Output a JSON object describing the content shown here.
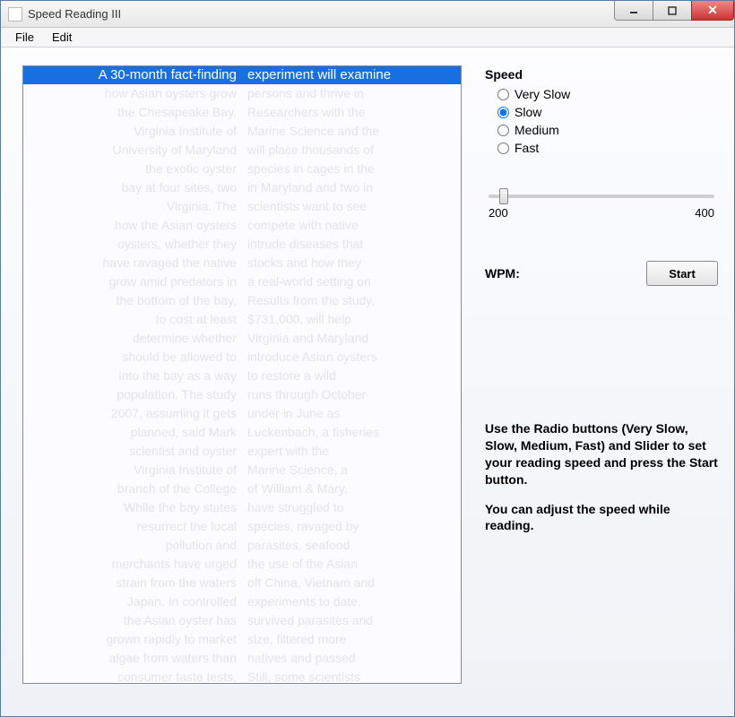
{
  "window": {
    "title": "Speed Reading III"
  },
  "menu": {
    "file": "File",
    "edit": "Edit"
  },
  "reading": {
    "current_left": "A 30-month fact-finding",
    "current_right": "experiment will examine",
    "faded": [
      {
        "l": "how Asian oysters grow",
        "r": "persons and thrive in"
      },
      {
        "l": "the Chesapeake Bay.",
        "r": "Researchers with the"
      },
      {
        "l": "Virginia Institute of",
        "r": "Marine Science and the"
      },
      {
        "l": "University of Maryland",
        "r": "will place thousands of"
      },
      {
        "l": "the exotic oyster",
        "r": "species in cages in the"
      },
      {
        "l": "bay at four sites, two",
        "r": "in Maryland and two in"
      },
      {
        "l": "Virginia. The",
        "r": "scientists want to see"
      },
      {
        "l": "how the Asian oysters",
        "r": "compete with native"
      },
      {
        "l": "oysters, whether they",
        "r": "intrude diseases that"
      },
      {
        "l": "have ravaged the native",
        "r": "stocks and how they"
      },
      {
        "l": "grow amid predators in",
        "r": "a real-world setting on"
      },
      {
        "l": "the bottom of the bay,",
        "r": "Results from the study,"
      },
      {
        "l": "to cost at least",
        "r": "$731,000, will help"
      },
      {
        "l": "determine whether",
        "r": "Virginia and Maryland"
      },
      {
        "l": "should be allowed to",
        "r": "introduce Asian oysters"
      },
      {
        "l": "into the bay as a way",
        "r": "to restore a wild"
      },
      {
        "l": "population. The study",
        "r": "runs through October"
      },
      {
        "l": "2007, assuming it gets",
        "r": "under in June as"
      },
      {
        "l": "planned, said Mark",
        "r": "Luckenbach, a fisheries"
      },
      {
        "l": "scientist and oyster",
        "r": "expert with the"
      },
      {
        "l": "Virginia Institute of",
        "r": "Marine Science, a"
      },
      {
        "l": "branch of the College",
        "r": "of William & Mary."
      },
      {
        "l": "While the bay states",
        "r": "have struggled to"
      },
      {
        "l": "resurrect the local",
        "r": "species, ravaged by"
      },
      {
        "l": "pollution and",
        "r": "parasites, seafood"
      },
      {
        "l": "merchants have urged",
        "r": "the use of the Asian"
      },
      {
        "l": "strain from the waters",
        "r": "off China, Vietnam and"
      },
      {
        "l": "Japan. In controlled",
        "r": "experiments to date,"
      },
      {
        "l": "the Asian oyster has",
        "r": "survived parasites and"
      },
      {
        "l": "grown rapidly to market",
        "r": "size, filtered more"
      },
      {
        "l": "algae from waters than",
        "r": "natives and passed"
      },
      {
        "l": "consumer taste tests.",
        "r": "Still, some scientists"
      }
    ]
  },
  "speed": {
    "label": "Speed",
    "options": {
      "very_slow": "Very Slow",
      "slow": "Slow",
      "medium": "Medium",
      "fast": "Fast"
    },
    "selected": "slow"
  },
  "slider": {
    "min": "200",
    "max": "400",
    "value": "210"
  },
  "wpm": {
    "label": "WPM:",
    "value": ""
  },
  "buttons": {
    "start": "Start"
  },
  "instructions": {
    "p1": "Use the Radio buttons (Very Slow, Slow, Medium, Fast) and Slider to set your reading speed and press the Start button.",
    "p2": "You can adjust the speed while reading."
  }
}
